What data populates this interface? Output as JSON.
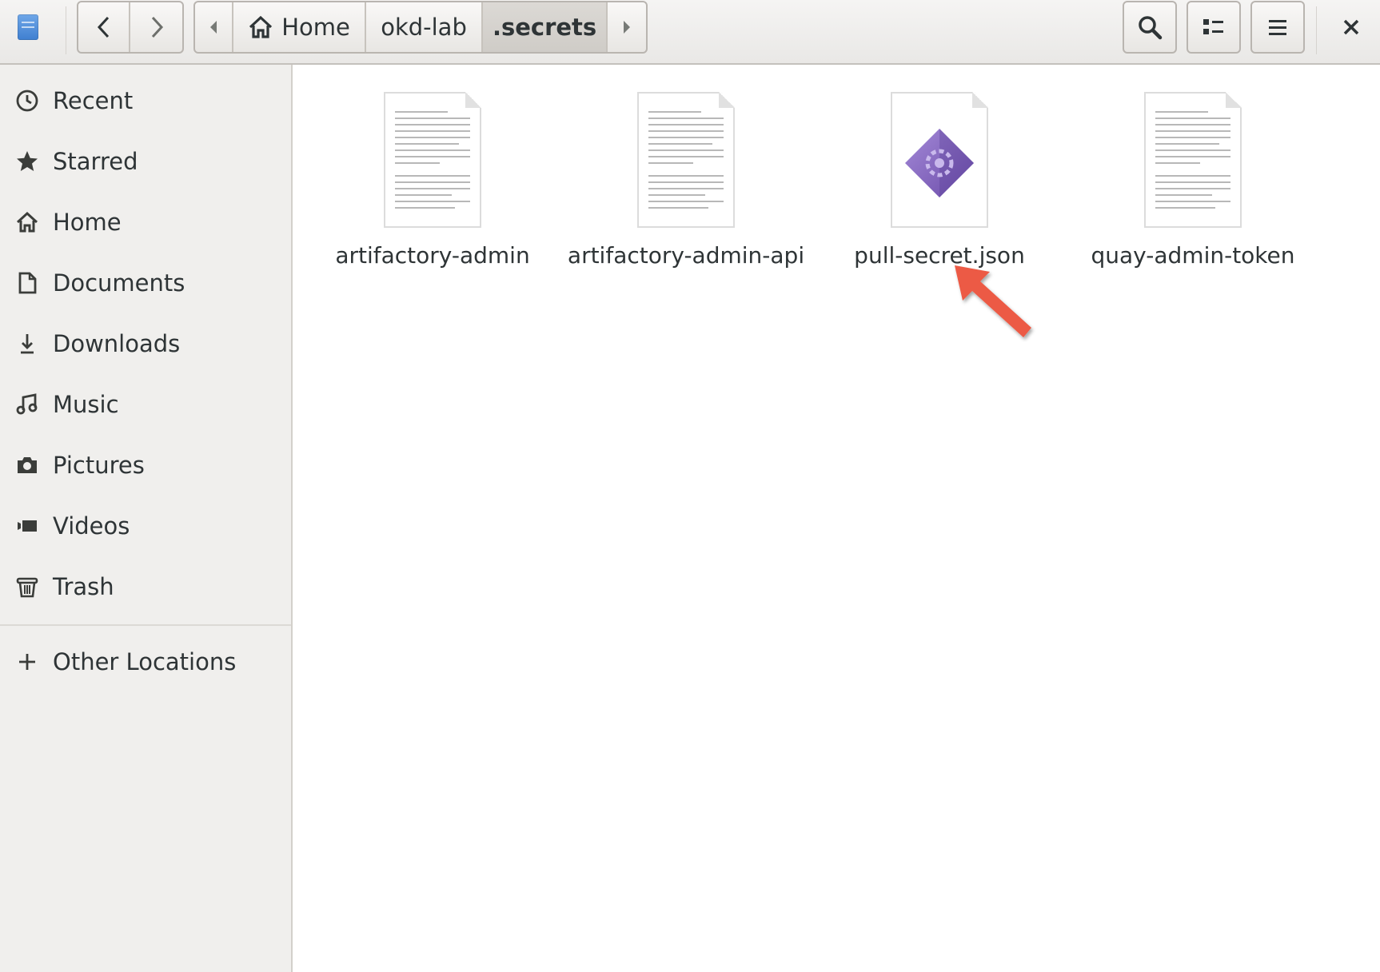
{
  "header": {
    "breadcrumbs": [
      {
        "label": "Home"
      },
      {
        "label": "okd-lab"
      },
      {
        "label": ".secrets"
      }
    ]
  },
  "sidebar": {
    "items": [
      {
        "label": "Recent",
        "icon": "clock-icon"
      },
      {
        "label": "Starred",
        "icon": "star-icon"
      },
      {
        "label": "Home",
        "icon": "home-icon"
      },
      {
        "label": "Documents",
        "icon": "document-icon"
      },
      {
        "label": "Downloads",
        "icon": "download-icon"
      },
      {
        "label": "Music",
        "icon": "music-icon"
      },
      {
        "label": "Pictures",
        "icon": "camera-icon"
      },
      {
        "label": "Videos",
        "icon": "video-icon"
      },
      {
        "label": "Trash",
        "icon": "trash-icon"
      }
    ],
    "other_locations": {
      "label": "Other Locations",
      "icon": "plus-icon"
    }
  },
  "files": [
    {
      "name": "artifactory-admin",
      "icon": "text-file-icon"
    },
    {
      "name": "artifactory-admin-api",
      "icon": "text-file-icon"
    },
    {
      "name": "pull-secret.json",
      "icon": "json-file-icon"
    },
    {
      "name": "quay-admin-token",
      "icon": "text-file-icon"
    }
  ],
  "colors": {
    "json_icon": "#8a6bc4",
    "cursor_arrow": "#e8503c"
  }
}
